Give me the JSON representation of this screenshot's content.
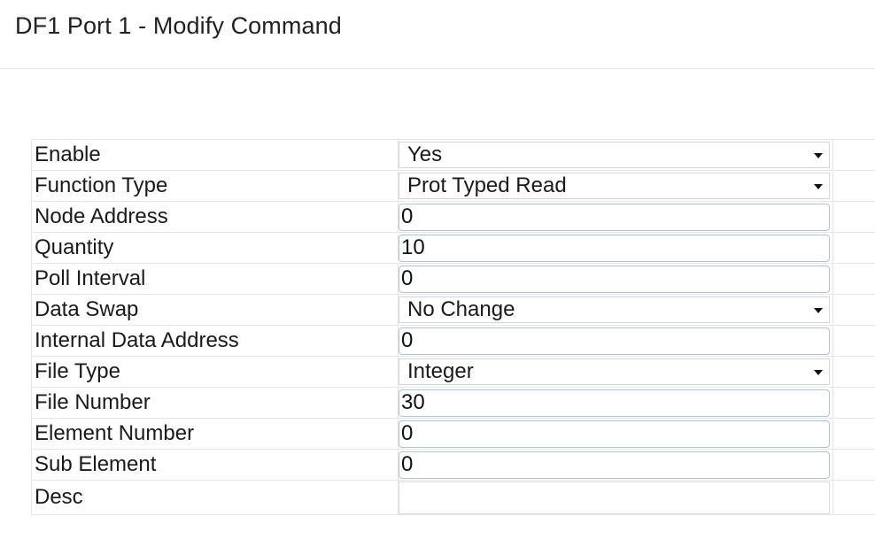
{
  "page": {
    "title": "DF1 Port 1 - Modify Command"
  },
  "form": {
    "enable": {
      "label": "Enable",
      "value": "Yes"
    },
    "function_type": {
      "label": "Function Type",
      "value": "Prot Typed Read"
    },
    "node_address": {
      "label": "Node Address",
      "value": "0"
    },
    "quantity": {
      "label": "Quantity",
      "value": "10"
    },
    "poll_interval": {
      "label": "Poll Interval",
      "value": "0"
    },
    "data_swap": {
      "label": "Data Swap",
      "value": "No Change"
    },
    "internal_data_address": {
      "label": "Internal Data Address",
      "value": "0"
    },
    "file_type": {
      "label": "File Type",
      "value": "Integer"
    },
    "file_number": {
      "label": "File Number",
      "value": "30"
    },
    "element_number": {
      "label": "Element Number",
      "value": "0"
    },
    "sub_element": {
      "label": "Sub Element",
      "value": "0"
    },
    "desc": {
      "label": "Desc",
      "value": ""
    }
  }
}
